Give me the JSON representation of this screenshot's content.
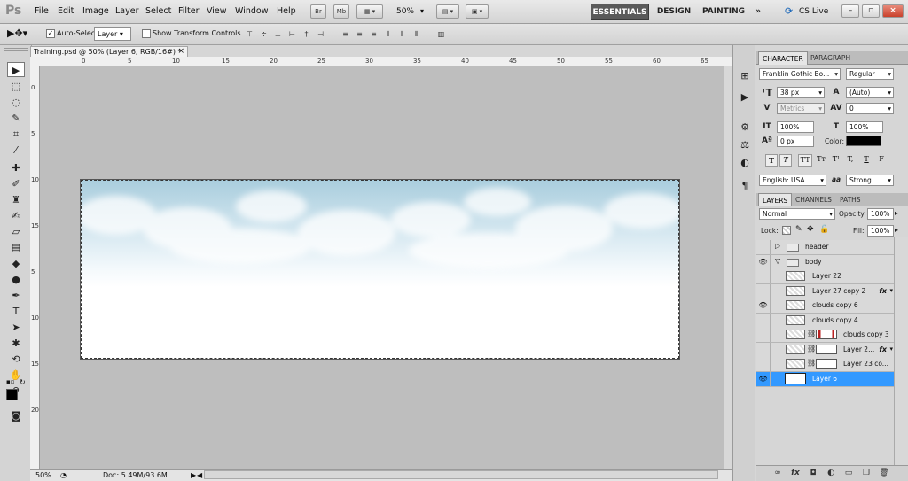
{
  "app": {
    "logo": "Ps"
  },
  "menu": [
    "File",
    "Edit",
    "Image",
    "Layer",
    "Select",
    "Filter",
    "View",
    "Window",
    "Help"
  ],
  "appbar": {
    "bridge": "Br",
    "minibridge": "Mb",
    "zoom": "50%"
  },
  "workspaces": {
    "essentials": "ESSENTIALS",
    "design": "DESIGN",
    "painting": "PAINTING",
    "more": "»",
    "cslive": "CS Live"
  },
  "options": {
    "auto_select_label": "Auto-Select:",
    "auto_select_value": "Layer",
    "transform_label": "Show Transform Controls"
  },
  "document": {
    "tab_title": "Training.psd @ 50% (Layer 6, RGB/16#) *",
    "close": "×",
    "ruler_top": [
      "0",
      "5",
      "10",
      "15",
      "20",
      "25",
      "30",
      "35",
      "40",
      "45",
      "50",
      "55",
      "60",
      "65"
    ],
    "ruler_left": [
      "0",
      "5",
      "10",
      "15",
      "0",
      "5",
      "10",
      "15",
      "20"
    ],
    "status_zoom": "50%",
    "status_doc": "Doc: 5.49M/93.6M"
  },
  "character": {
    "tabs": [
      "CHARACTER",
      "PARAGRAPH"
    ],
    "font_family": "Franklin Gothic Bo...",
    "font_style": "Regular",
    "size": "38 px",
    "leading": "(Auto)",
    "kerning": "Metrics",
    "tracking": "0",
    "vscale": "100%",
    "hscale": "100%",
    "baseline": "0 px",
    "color_label": "Color:",
    "text_color": "#000000",
    "format_buttons": [
      "T",
      "T",
      "TT",
      "Tт",
      "T¹",
      "T,",
      "T",
      "F"
    ],
    "language": "English: USA",
    "aa_icon": "aa",
    "antialias": "Strong"
  },
  "layers": {
    "tabs": [
      "LAYERS",
      "CHANNELS",
      "PATHS"
    ],
    "blend_mode": "Normal",
    "opacity_label": "Opacity:",
    "opacity": "100%",
    "lock_label": "Lock:",
    "fill_label": "Fill:",
    "fill": "100%",
    "items": [
      {
        "name": "header",
        "type": "group",
        "visible": false,
        "expanded": false
      },
      {
        "name": "body",
        "type": "group",
        "visible": true,
        "expanded": true
      },
      {
        "name": "Layer 22",
        "type": "layer",
        "visible": false
      },
      {
        "name": "Layer 27 copy 2",
        "type": "layer",
        "visible": false,
        "fx": "fx"
      },
      {
        "name": "clouds copy 6",
        "type": "layer",
        "visible": true
      },
      {
        "name": "clouds copy 4",
        "type": "layer",
        "visible": false
      },
      {
        "name": "clouds copy 3",
        "type": "layer",
        "visible": false,
        "mask": true
      },
      {
        "name": "Layer 2...",
        "type": "layer",
        "visible": false,
        "mask": true,
        "fx": "fx"
      },
      {
        "name": "Layer 23 co...",
        "type": "layer",
        "visible": false,
        "mask": true
      },
      {
        "name": "Layer 6",
        "type": "layer",
        "visible": true,
        "selected": true
      }
    ]
  },
  "colors": {
    "accent": "#3399ff",
    "canvas_bg": "#bebebe",
    "panel_bg": "#d6d6d6"
  }
}
